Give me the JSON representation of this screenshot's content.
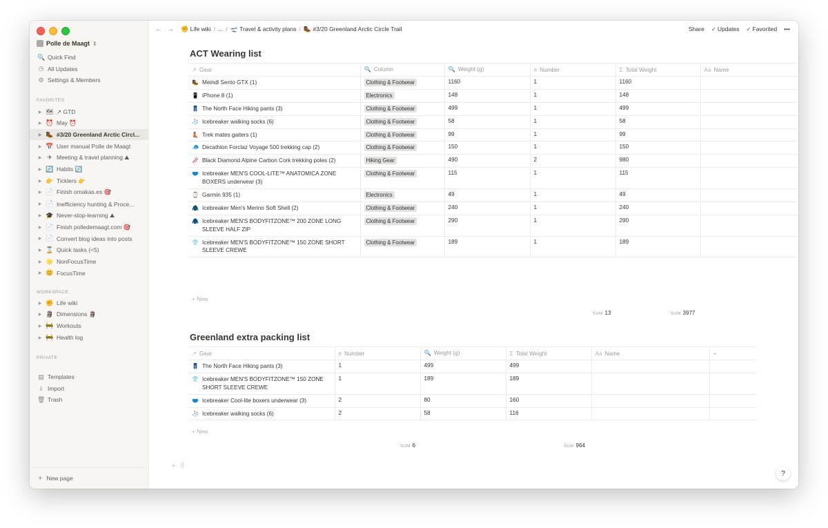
{
  "workspace": {
    "name": "Polle de Maagt"
  },
  "sidebar": {
    "top_items": [
      {
        "icon": "🔍",
        "label": "Quick Find"
      },
      {
        "icon": "◷",
        "label": "All Updates"
      },
      {
        "icon": "⚙",
        "label": "Settings & Members"
      }
    ],
    "favorites_heading": "FAVORITES",
    "favorites": [
      {
        "icon": "🗺",
        "label": "↗ GTD"
      },
      {
        "icon": "⏰",
        "label": "May ⏰"
      },
      {
        "icon": "🥾",
        "label": "#3/20 Greenland Arctic Circl..."
      },
      {
        "icon": "📅",
        "label": "User manual Polle de Maagt"
      },
      {
        "icon": "✈",
        "label": "Meeting & travel planning ⛰"
      },
      {
        "icon": "🔄",
        "label": "Habits 🔄"
      },
      {
        "icon": "👉",
        "label": "Ticklers 👉"
      },
      {
        "icon": "📄",
        "label": "Finish omakas.es 🎯"
      },
      {
        "icon": "📄",
        "label": "Inefficiency hunting & Proce..."
      },
      {
        "icon": "🎓",
        "label": "Never-stop-learning ⛰"
      },
      {
        "icon": "📄",
        "label": "Finish polledemaagt.com 🎯"
      },
      {
        "icon": "📄",
        "label": "Convert blog ideas into posts"
      },
      {
        "icon": "⌛",
        "label": "Quick tasks (<5)"
      },
      {
        "icon": "🌟",
        "label": "NonFocusTime"
      },
      {
        "icon": "😊",
        "label": "FocusTime"
      }
    ],
    "workspace_heading": "WORKSPACE",
    "workspace_items": [
      {
        "icon": "✊",
        "label": "Life wiki"
      },
      {
        "icon": "🗿",
        "label": "Dimensions 🗿"
      },
      {
        "icon": "🚧",
        "label": "Workouts"
      },
      {
        "icon": "🚧",
        "label": "Health log"
      }
    ],
    "private_heading": "PRIVATE",
    "bottom_items": [
      {
        "icon": "▤",
        "label": "Templates"
      },
      {
        "icon": "⤓",
        "label": "Import"
      },
      {
        "icon": "🗑",
        "label": "Trash"
      }
    ],
    "new_page_label": "New page"
  },
  "topbar": {
    "breadcrumbs": [
      {
        "icon": "✊",
        "label": "Life wiki"
      },
      {
        "icon": "",
        "label": "..."
      },
      {
        "icon": "🛫",
        "label": "Travel & activity plans"
      },
      {
        "icon": "🥾",
        "label": "#3/20 Greenland Arctic Circle Trail"
      }
    ],
    "share_label": "Share",
    "updates_label": "Updates",
    "favorited_label": "Favorited",
    "more_label": "•••"
  },
  "act_list": {
    "title": "ACT Wearing list",
    "columns": [
      {
        "icon": "↗",
        "label": "Gear"
      },
      {
        "icon": "🔍",
        "label": "Column"
      },
      {
        "icon": "🔍",
        "label": "Weight (g)"
      },
      {
        "icon": "#",
        "label": "Number"
      },
      {
        "icon": "Σ",
        "label": "Total Weight"
      },
      {
        "icon": "Aa",
        "label": "Name"
      }
    ],
    "rows": [
      {
        "icon": "🥾",
        "gear": "Meindl Sento GTX (1)",
        "column": "Clothing & Footwear",
        "weight": "1160",
        "number": "1",
        "total": "1160"
      },
      {
        "icon": "📱",
        "gear": "iPhone 8 (1)",
        "column": "Electronics",
        "weight": "148",
        "number": "1",
        "total": "148"
      },
      {
        "icon": "👖",
        "gear": "The North Face Hiking pants (3)",
        "column": "Clothing & Footwear",
        "weight": "499",
        "number": "1",
        "total": "499"
      },
      {
        "icon": "🧦",
        "gear": "Icebreaker walking socks (6)",
        "column": "Clothing & Footwear",
        "weight": "58",
        "number": "1",
        "total": "58"
      },
      {
        "icon": "👢",
        "gear": "Trek mates gaiters (1)",
        "column": "Clothing & Footwear",
        "weight": "99",
        "number": "1",
        "total": "99"
      },
      {
        "icon": "🧢",
        "gear": "Decathlon Forclaz Voyage 500 trekking cap (2)",
        "column": "Clothing & Footwear",
        "weight": "150",
        "number": "1",
        "total": "150"
      },
      {
        "icon": "🥢",
        "gear": "Black Diamond Alpine Carbon Cork trekking poles (2)",
        "column": "Hiking Gear",
        "weight": "490",
        "number": "2",
        "total": "980"
      },
      {
        "icon": "🩲",
        "gear": "Icebreaker MEN'S COOL-LITE™ ANATOMICA ZONE BOXERS underwear (3)",
        "column": "Clothing & Footwear",
        "weight": "115",
        "number": "1",
        "total": "115"
      },
      {
        "icon": "⌚",
        "gear": "Garmin 935 (1)",
        "column": "Electronics",
        "weight": "49",
        "number": "1",
        "total": "49"
      },
      {
        "icon": "🧥",
        "gear": "Icebreaker Men's Merino Soft Shell (2)",
        "column": "Clothing & Footwear",
        "weight": "240",
        "number": "1",
        "total": "240"
      },
      {
        "icon": "🧥",
        "gear": "Icebreaker MEN'S BODYFITZONE™ 200 ZONE LONG SLEEVE HALF ZIP",
        "column": "Clothing & Footwear",
        "weight": "290",
        "number": "1",
        "total": "290"
      },
      {
        "icon": "👕",
        "gear": "Icebreaker MEN'S BODYFITZONE™ 150 ZONE SHORT SLEEVE CREWE",
        "column": "Clothing & Footwear",
        "weight": "189",
        "number": "1",
        "total": "189"
      }
    ],
    "new_label": "New",
    "sum_label": "SUM",
    "sum_number": "13",
    "sum_total": "3977"
  },
  "extra_list": {
    "title": "Greenland extra packing list",
    "columns": [
      {
        "icon": "↗",
        "label": "Gear"
      },
      {
        "icon": "#",
        "label": "Number"
      },
      {
        "icon": "🔍",
        "label": "Weight (g)"
      },
      {
        "icon": "Σ",
        "label": "Total Weight"
      },
      {
        "icon": "Aa",
        "label": "Name"
      },
      {
        "icon": "+",
        "label": ""
      }
    ],
    "rows": [
      {
        "icon": "👖",
        "gear": "The North Face Hiking pants (3)",
        "number": "1",
        "weight": "499",
        "total": "499"
      },
      {
        "icon": "👕",
        "gear": "Icebreaker MEN'S BODYFITZONE™ 150 ZONE SHORT SLEEVE CREWE",
        "number": "1",
        "weight": "189",
        "total": "189"
      },
      {
        "icon": "🩲",
        "gear": "Icebreaker Cool-lite boxers underwear (3)",
        "number": "2",
        "weight": "80",
        "total": "160"
      },
      {
        "icon": "🧦",
        "gear": "Icebreaker walking socks (6)",
        "number": "2",
        "weight": "58",
        "total": "116"
      }
    ],
    "new_label": "New",
    "sum_label": "SUM",
    "sum_number": "6",
    "sum_total": "964"
  },
  "help_label": "?"
}
